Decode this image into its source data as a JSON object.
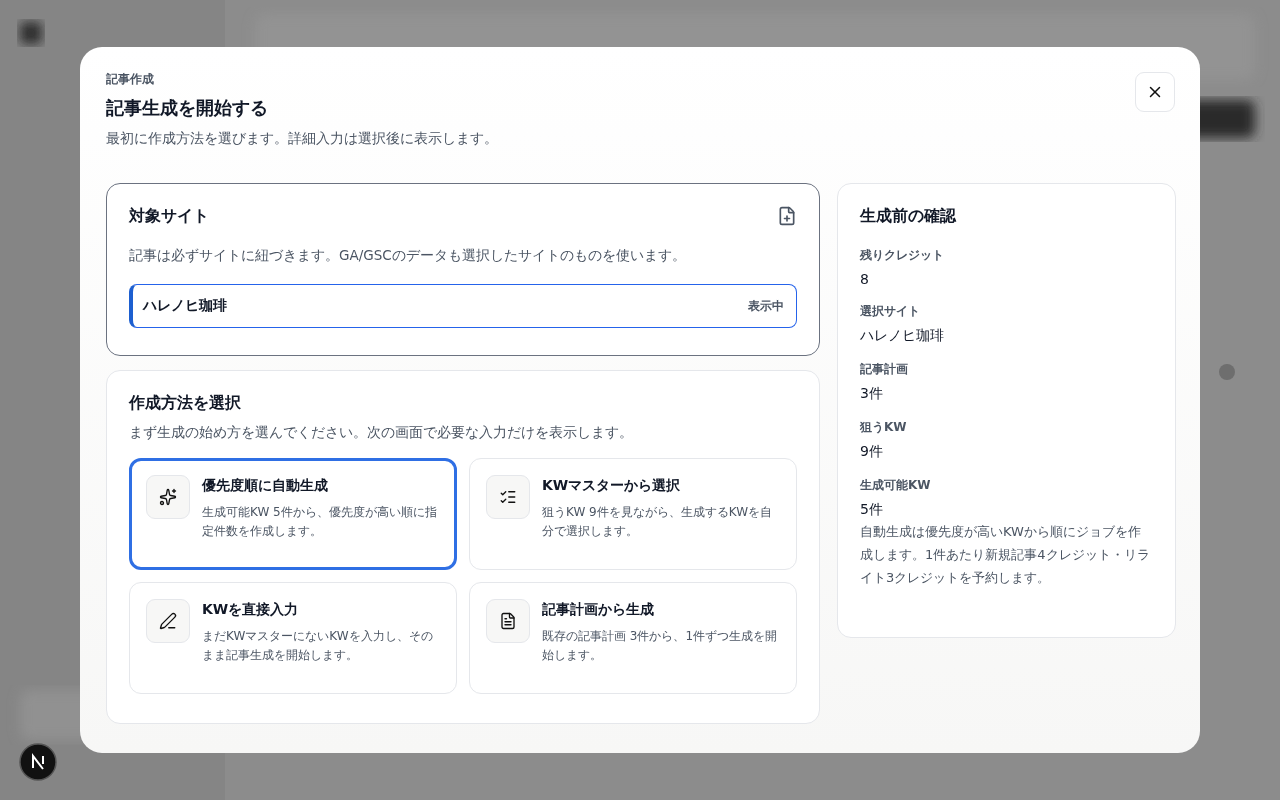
{
  "dialog": {
    "eyebrow": "記事作成",
    "title": "記事生成を開始する",
    "description": "最初に作成方法を選びます。詳細入力は選択後に表示します。"
  },
  "site_section": {
    "title": "対象サイト",
    "description": "記事は必ずサイトに紐づきます。GA/GSCのデータも選択したサイトのものを使います。",
    "site": {
      "name": "ハレノヒ珈琲",
      "badge": "表示中",
      "selected": true
    }
  },
  "method_section": {
    "title": "作成方法を選択",
    "description": "まず生成の始め方を選んでください。次の画面で必要な入力だけを表示します。",
    "options": [
      {
        "kind": "sparkle",
        "title": "優先度順に自動生成",
        "description": "生成可能KW 5件から、優先度が高い順に指定件数を作成します。",
        "selected": true
      },
      {
        "kind": "checklist",
        "title": "KWマスターから選択",
        "description": "狙うKW 9件を見ながら、生成するKWを自分で選択します。",
        "selected": false
      },
      {
        "kind": "pencil",
        "title": "KWを直接入力",
        "description": "まだKWマスターにないKWを入力し、そのまま記事生成を開始します。",
        "selected": false
      },
      {
        "kind": "document",
        "title": "記事計画から生成",
        "description": "既存の記事計画 3件から、1件ずつ生成を開始します。",
        "selected": false
      }
    ]
  },
  "summary": {
    "title": "生成前の確認",
    "items": [
      {
        "label": "残りクレジット",
        "value": "8"
      },
      {
        "label": "選択サイト",
        "value": "ハレノヒ珈琲"
      },
      {
        "label": "記事計画",
        "value": "3件"
      },
      {
        "label": "狙うKW",
        "value": "9件"
      },
      {
        "label": "生成可能KW",
        "value": "5件"
      }
    ],
    "note": "自動生成は優先度が高いKWから順にジョブを作成します。1件あたり新規記事4クレジット・リライト3クレジットを予約します。"
  }
}
